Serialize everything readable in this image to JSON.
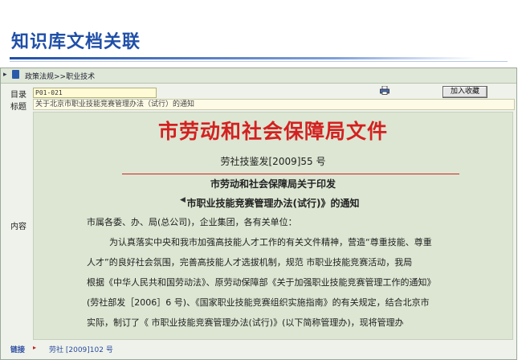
{
  "slide": {
    "title": "知识库文档关联"
  },
  "breadcrumb": {
    "text": "政策法规>>职业技术"
  },
  "catalog": {
    "label": "目录",
    "value": "P01-021"
  },
  "favorite_button": {
    "label": "加入收藏"
  },
  "title_field": {
    "label": "标题",
    "value": "关于北京市职业技能竞赛管理办法（试行）的通知"
  },
  "content": {
    "label": "内容",
    "header": "市劳动和社会保障局文件",
    "doc_number": "劳社技鉴发[2009]55 号",
    "subject_line1": "市劳动和社会保障局关于印发",
    "subject_line2": "市职业技能竞赛管理办法(试行)》的通知",
    "subject_mark": "◀",
    "body": [
      "市属各委、办、局(总公司)，企业集团，各有关单位：",
      "为认真落实中央和我市加强高技能人才工作的有关文件精神，营造“尊重技能、尊重",
      "人才”的良好社会氛围，完善高技能人才选拔机制，规范   市职业技能竞赛活动，我局",
      "根据《中华人民共和国劳动法》、原劳动保障部《关于加强职业技能竞赛管理工作的通知》",
      "(劳社部发［2006］6 号)、《国家职业技能竞赛组织实施指南》的有关规定，结合北京市",
      "实际，制订了《     市职业技能竞赛管理办法(试行)》(以下简称管理办)，现将管理办"
    ]
  },
  "link": {
    "label": "链接",
    "arrow": "▸",
    "value": "劳社 [2009]102 号"
  },
  "colors": {
    "title_blue": "#1f4fa8",
    "header_red": "#d42020",
    "content_bg": "#dce6d2"
  }
}
